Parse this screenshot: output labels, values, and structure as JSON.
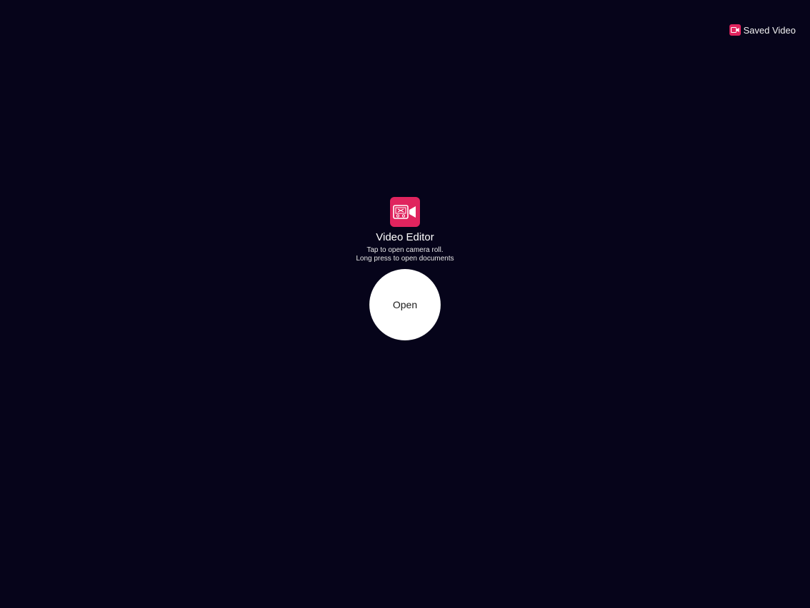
{
  "header": {
    "saved_video_label": "Saved Video",
    "saved_video_icon": "video-camera-icon"
  },
  "main": {
    "app_icon": "video-editor-icon",
    "title": "Video Editor",
    "hint_line1": "Tap to open camera roll.",
    "hint_line2": "Long press to open documents",
    "open_button_label": "Open"
  },
  "colors": {
    "background": "#06041a",
    "accent": "#e0245e",
    "button": "#ffffff"
  }
}
